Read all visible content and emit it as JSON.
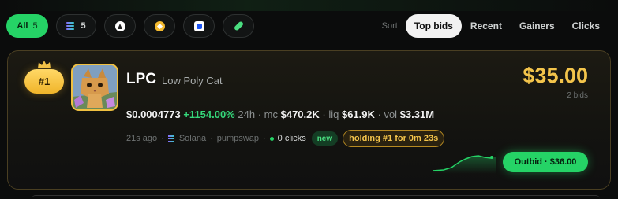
{
  "filters": {
    "all_label": "All",
    "all_count": "5",
    "solana_count": "5",
    "chains": [
      "ethereum-icon",
      "bnb-icon",
      "base-icon",
      "pump-icon"
    ]
  },
  "sort": {
    "label": "Sort",
    "options": [
      "Top bids",
      "Recent",
      "Gainers",
      "Clicks"
    ],
    "active": "Top bids"
  },
  "listing": {
    "rank": "#1",
    "ticker": "LPC",
    "name": "Low Poly Cat",
    "price": "$0.0004773",
    "change": "+1154.00%",
    "period": "24h",
    "mc_label": "mc",
    "mc": "$470.2K",
    "liq_label": "liq",
    "liq": "$61.9K",
    "vol_label": "vol",
    "vol": "$3.31M",
    "age": "21s ago",
    "chain": "Solana",
    "dex": "pumpswap",
    "clicks": "0 clicks",
    "new_badge": "new",
    "holding": "holding #1 for 0m 23s",
    "bid_amount": "$35.00",
    "bid_count": "2 bids",
    "outbid_label": "Outbid · $36.00"
  },
  "colors": {
    "accent_green": "#25d366",
    "gold": "#f3c44b"
  }
}
